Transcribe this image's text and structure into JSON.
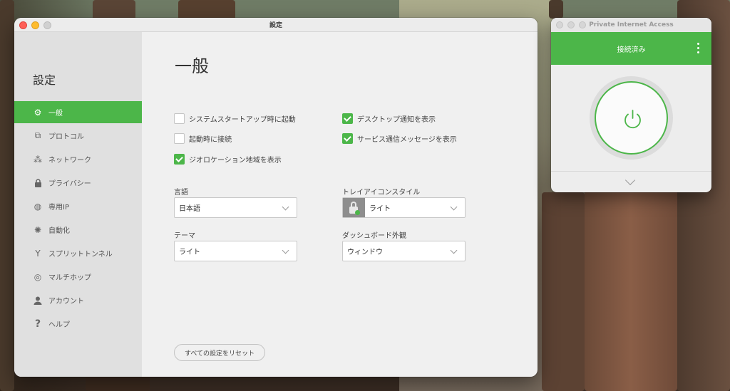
{
  "settings_window": {
    "title": "設定",
    "sidebar": {
      "title": "設定",
      "items": [
        {
          "label": "一般",
          "icon": "gear-icon",
          "glyph": "⚙",
          "active": true
        },
        {
          "label": "プロトコル",
          "icon": "protocol-icon",
          "glyph": "⧉",
          "active": false
        },
        {
          "label": "ネットワーク",
          "icon": "network-icon",
          "glyph": "⁂",
          "active": false
        },
        {
          "label": "プライバシー",
          "icon": "lock-icon",
          "glyph": "🔒︎",
          "active": false
        },
        {
          "label": "専用IP",
          "icon": "globe-icon",
          "glyph": "◍",
          "active": false
        },
        {
          "label": "自動化",
          "icon": "bulb-icon",
          "glyph": "✺",
          "active": false
        },
        {
          "label": "スプリットトンネル",
          "icon": "split-icon",
          "glyph": "Y",
          "active": false
        },
        {
          "label": "マルチホップ",
          "icon": "multihop-icon",
          "glyph": "◎",
          "active": false
        },
        {
          "label": "アカウント",
          "icon": "user-icon",
          "glyph": "●",
          "active": false
        },
        {
          "label": "ヘルプ",
          "icon": "help-icon",
          "glyph": "?",
          "active": false
        }
      ]
    },
    "page_title": "一般",
    "checkboxes": {
      "launch_startup": {
        "label": "システムスタートアップ時に起動",
        "checked": false
      },
      "connect_launch": {
        "label": "起動時に接続",
        "checked": false
      },
      "geo_regions": {
        "label": "ジオロケーション地域を表示",
        "checked": true
      },
      "desktop_notify": {
        "label": "デスクトップ通知を表示",
        "checked": true
      },
      "service_messages": {
        "label": "サービス通信メッセージを表示",
        "checked": true
      }
    },
    "language": {
      "label": "言語",
      "value": "日本語"
    },
    "tray_icon_style": {
      "label": "トレイアイコンスタイル",
      "value": "ライト"
    },
    "theme": {
      "label": "テーマ",
      "value": "ライト"
    },
    "dashboard_appearance": {
      "label": "ダッシュボード外観",
      "value": "ウィンドウ"
    },
    "reset_button": "すべての設定をリセット"
  },
  "pia_window": {
    "title": "Private Internet Access",
    "status": "接続済み",
    "accent_color": "#4cb649"
  }
}
